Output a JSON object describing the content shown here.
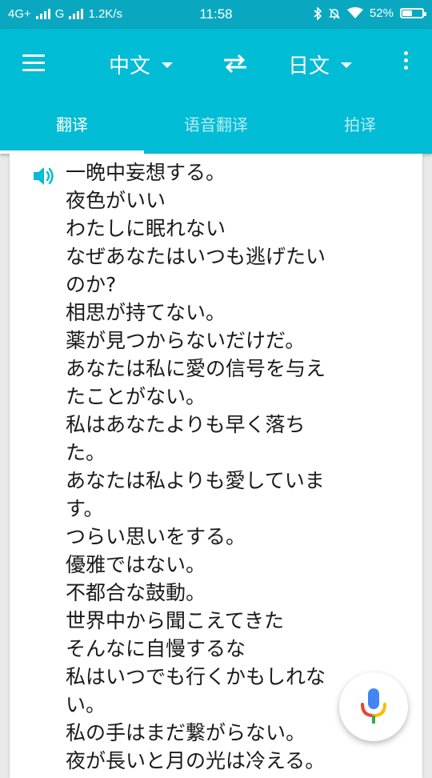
{
  "status_bar": {
    "network_left": "4G+",
    "network_right": "G",
    "speed": "1.2K/s",
    "time": "11:58",
    "battery_text": "52%",
    "battery_level": 0.52,
    "icons": [
      "signal-icon",
      "bluetooth-icon",
      "mute-bell-icon",
      "wifi-icon",
      "battery-icon"
    ]
  },
  "app_bar": {
    "source_lang": "中文",
    "target_lang": "日文",
    "icons": [
      "menu-icon",
      "dropdown-caret-icon",
      "swap-icon",
      "more-vert-icon"
    ],
    "colors": {
      "primary": "#00bcd4",
      "status_bar": "#0aa8c0",
      "text": "#ffffff"
    }
  },
  "tabs": [
    {
      "label": "翻译",
      "active": true
    },
    {
      "label": "语音翻译",
      "active": false
    },
    {
      "label": "拍译",
      "active": false
    }
  ],
  "result": {
    "speaker_icon": "speaker-icon",
    "lines": [
      "一晩中妄想する。",
      "夜色がいい",
      "わたしに眠れない",
      "なぜあなたはいつも逃げたい",
      "のか?",
      "相思が持てない。",
      "薬が見つからないだけだ。",
      "あなたは私に愛の信号を与え",
      "たことがない。",
      "私はあなたよりも早く落ち",
      "た。",
      "あなたは私よりも愛していま",
      "す。",
      "つらい思いをする。",
      "優雅ではない。",
      "不都合な鼓動。",
      "世界中から聞こえてきた",
      "そんなに自慢するな",
      "私はいつでも行くかもしれな",
      "い。",
      "私の手はまだ繋がらない。",
      "夜が長いと月の光は冷える。"
    ]
  },
  "mic_button": {
    "icon": "microphone-icon",
    "colors": [
      "#4285f4",
      "#ea4335",
      "#fbbc05",
      "#34a853"
    ]
  }
}
